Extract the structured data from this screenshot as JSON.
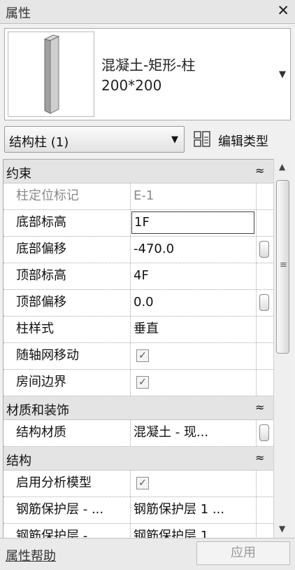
{
  "window": {
    "title": "属性",
    "close_glyph": "✕"
  },
  "type_selector": {
    "name_line1": "混凝土-矩形-柱",
    "name_line2": "200*200",
    "dropdown_glyph": "▼"
  },
  "filter": {
    "value": "结构柱 (1)",
    "dropdown_glyph": "▼",
    "edit_type_label": "编辑类型"
  },
  "sections": [
    {
      "label": "约束",
      "chevron": "≈",
      "rows": [
        {
          "name": "柱定位标记",
          "value": "E-1",
          "dim": true
        },
        {
          "name": "底部标高",
          "value": "1F",
          "editing": true
        },
        {
          "name": "底部偏移",
          "value": "-470.0",
          "button": true
        },
        {
          "name": "顶部标高",
          "value": "4F"
        },
        {
          "name": "顶部偏移",
          "value": "0.0",
          "button": true
        },
        {
          "name": "柱样式",
          "value": "垂直"
        },
        {
          "name": "随轴网移动",
          "checkbox": true,
          "checked": true
        },
        {
          "name": "房间边界",
          "checkbox": true,
          "checked": true
        }
      ]
    },
    {
      "label": "材质和装饰",
      "chevron": "≈",
      "rows": [
        {
          "name": "结构材质",
          "value": "混凝土 - 现...",
          "button": true
        }
      ]
    },
    {
      "label": "结构",
      "chevron": "≈",
      "rows": [
        {
          "name": "启用分析模型",
          "checkbox": true,
          "checked": true
        },
        {
          "name": "钢筋保护层 - ...",
          "value": "钢筋保护层 1 ..."
        },
        {
          "name": "钢筋保护层 -",
          "value": "钢筋保护层 1"
        }
      ]
    }
  ],
  "scrollbar": {
    "up_glyph": "▲",
    "down_glyph": "▼",
    "grip_glyph": "≡"
  },
  "footer": {
    "help_link": "属性帮助",
    "apply_label": "应用"
  },
  "colors": {
    "section_bg": "#e4e4e4",
    "dim_text": "#8a8a8a"
  }
}
